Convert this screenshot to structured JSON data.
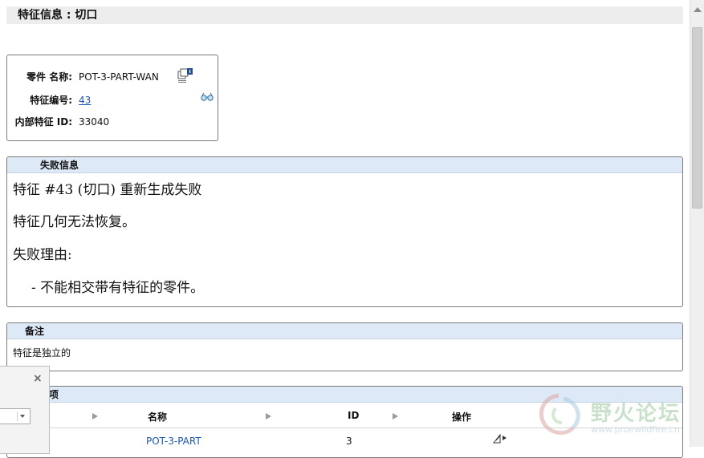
{
  "header": {
    "title": "特征信息 : 切口"
  },
  "part": {
    "name_label": "零件 名称:",
    "name_value": "POT-3-PART-WAN",
    "feature_no_label": "特征编号:",
    "feature_no_value": "43",
    "internal_id_label": "内部特征 ID:",
    "internal_id_value": "33040"
  },
  "failure": {
    "title": "失败信息",
    "line1": "特征 #43 (切口) 重新生成失败",
    "line2": "特征几何无法恢复。",
    "line3": "失败理由:",
    "line4": "- 不能相交带有特征的零件。"
  },
  "notes": {
    "title": "备注",
    "text": "特征是独立的"
  },
  "list": {
    "title_fragment": "项",
    "columns": [
      "名称",
      "ID",
      "操作"
    ],
    "rows": [
      {
        "name": "POT-3-PART",
        "id": "3"
      }
    ]
  },
  "popup": {
    "close": "×"
  },
  "watermark": {
    "text": "野火论坛",
    "url": "www.proewildfire.cn"
  },
  "icons": {
    "copy": "copy-info-icon",
    "glasses": "glasses-icon",
    "ops": "edit-ops-icon",
    "sort": "sort-arrow-icon"
  }
}
